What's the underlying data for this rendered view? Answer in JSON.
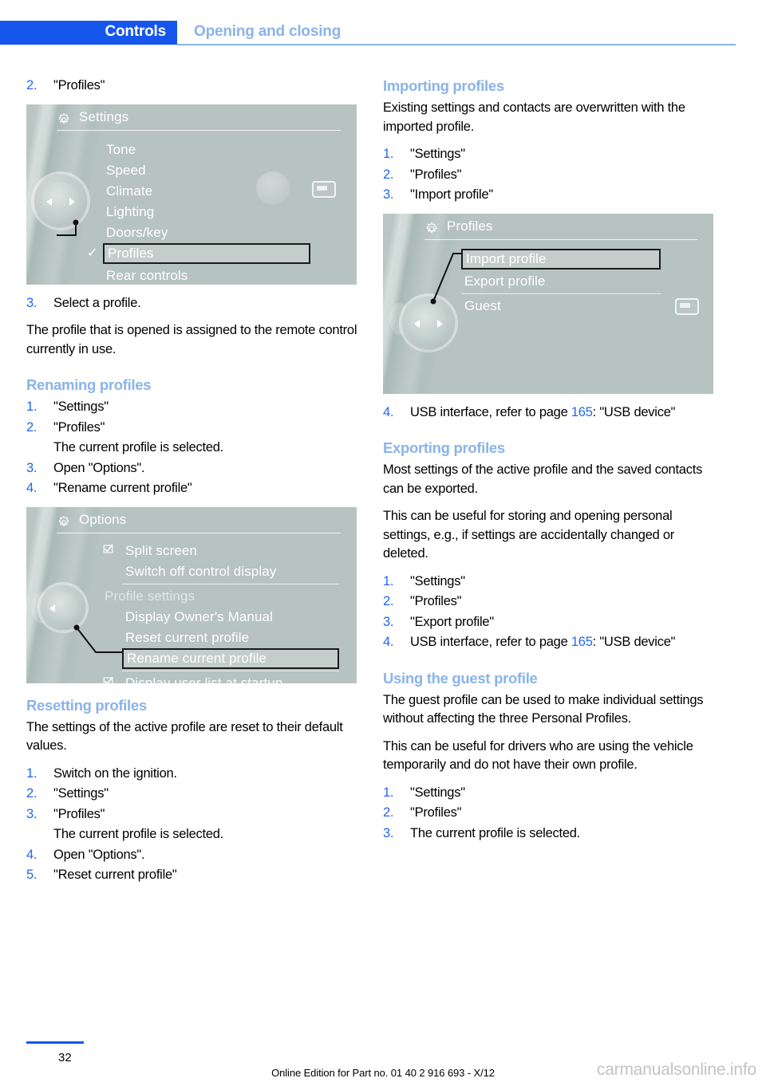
{
  "header": {
    "tab_label": "Controls",
    "section_label": "Opening and closing"
  },
  "left_column": {
    "step2": {
      "num": "2.",
      "text": "\"Profiles\""
    },
    "settings_screen": {
      "title": "Settings",
      "gear_icon": "gear-icon",
      "items": [
        {
          "label": "Tone",
          "selected": false,
          "check": false
        },
        {
          "label": "Speed",
          "selected": false,
          "check": false
        },
        {
          "label": "Climate",
          "selected": false,
          "check": false
        },
        {
          "label": "Lighting",
          "selected": false,
          "check": false
        },
        {
          "label": "Doors/key",
          "selected": false,
          "check": false
        },
        {
          "label": "Profiles",
          "selected": true,
          "check": true
        },
        {
          "label": "Rear controls",
          "selected": false,
          "check": false
        }
      ]
    },
    "step3": {
      "num": "3.",
      "text": "Select a profile."
    },
    "para_assigned": "The profile that is opened is assigned to the remote control currently in use.",
    "renaming": {
      "heading": "Renaming profiles",
      "items": [
        {
          "num": "1.",
          "text": "\"Settings\""
        },
        {
          "num": "2.",
          "text": "\"Profiles\""
        },
        {
          "num": "3.",
          "text": "Open \"Options\"."
        },
        {
          "num": "4.",
          "text": "\"Rename current profile\""
        }
      ],
      "subtext_after_2": "The current profile is selected."
    },
    "options_screen": {
      "title": "Options",
      "gear_icon": "gear-icon",
      "items": [
        {
          "label": "Split screen",
          "checkbox": true
        },
        {
          "label": "Switch off control display",
          "checkbox": false
        },
        {
          "label": "Profile settings",
          "checkbox": false,
          "group": true
        },
        {
          "label": "Display Owner's Manual",
          "checkbox": false
        },
        {
          "label": "Reset current profile",
          "checkbox": false
        },
        {
          "label": "Rename current profile",
          "checkbox": false,
          "selected": true
        },
        {
          "label": "Display user list at startup",
          "checkbox": true
        }
      ]
    },
    "resetting": {
      "heading": "Resetting profiles",
      "para": "The settings of the active profile are reset to their default values.",
      "items": [
        {
          "num": "1.",
          "text": "Switch on the ignition."
        },
        {
          "num": "2.",
          "text": "\"Settings\""
        },
        {
          "num": "3.",
          "text": "\"Profiles\""
        },
        {
          "num": "4.",
          "text": "Open \"Options\"."
        },
        {
          "num": "5.",
          "text": "\"Reset current profile\""
        }
      ],
      "subtext_after_3": "The current profile is selected."
    }
  },
  "right_column": {
    "importing": {
      "heading": "Importing profiles",
      "para": "Existing settings and contacts are overwritten with the imported profile.",
      "items": [
        {
          "num": "1.",
          "text": "\"Settings\""
        },
        {
          "num": "2.",
          "text": "\"Profiles\""
        },
        {
          "num": "3.",
          "text": "\"Import profile\""
        }
      ]
    },
    "profiles_screen": {
      "title": "Profiles",
      "gear_icon": "gear-icon",
      "items": [
        {
          "label": "Import profile",
          "selected": true
        },
        {
          "label": "Export profile",
          "selected": false
        },
        {
          "label": "Guest",
          "selected": false
        }
      ]
    },
    "import_step4": {
      "num": "4.",
      "text_before": "USB interface, refer to page ",
      "page_ref": "165",
      "text_after": ": \"USB device\""
    },
    "exporting": {
      "heading": "Exporting profiles",
      "para1": "Most settings of the active profile and the saved contacts can be exported.",
      "para2": "This can be useful for storing and opening personal settings, e.g., if settings are accidentally changed or deleted.",
      "items": [
        {
          "num": "1.",
          "text": "\"Settings\""
        },
        {
          "num": "2.",
          "text": "\"Profiles\""
        },
        {
          "num": "3.",
          "text": "\"Export profile\""
        }
      ],
      "step4": {
        "num": "4.",
        "text_before": "USB interface, refer to page ",
        "page_ref": "165",
        "text_after": ": \"USB device\""
      }
    },
    "guest": {
      "heading": "Using the guest profile",
      "para1": "The guest profile can be used to make individual settings without affecting the three Personal Profiles.",
      "para2": "This can be useful for drivers who are using the vehicle temporarily and do not have their own profile.",
      "items": [
        {
          "num": "1.",
          "text": "\"Settings\""
        },
        {
          "num": "2.",
          "text": "\"Profiles\""
        },
        {
          "num": "3.",
          "text": "The current profile is selected."
        }
      ]
    }
  },
  "footer": {
    "page_number": "32",
    "edition_text": "Online Edition for Part no. 01 40 2 916 693 - X/12",
    "watermark": "carmanualsonline.info"
  },
  "colors": {
    "tab_blue": "#1656ec",
    "heading_blue": "#8ab3ea",
    "number_blue": "#2266ee",
    "screen_gray": "#b6c3c0"
  }
}
